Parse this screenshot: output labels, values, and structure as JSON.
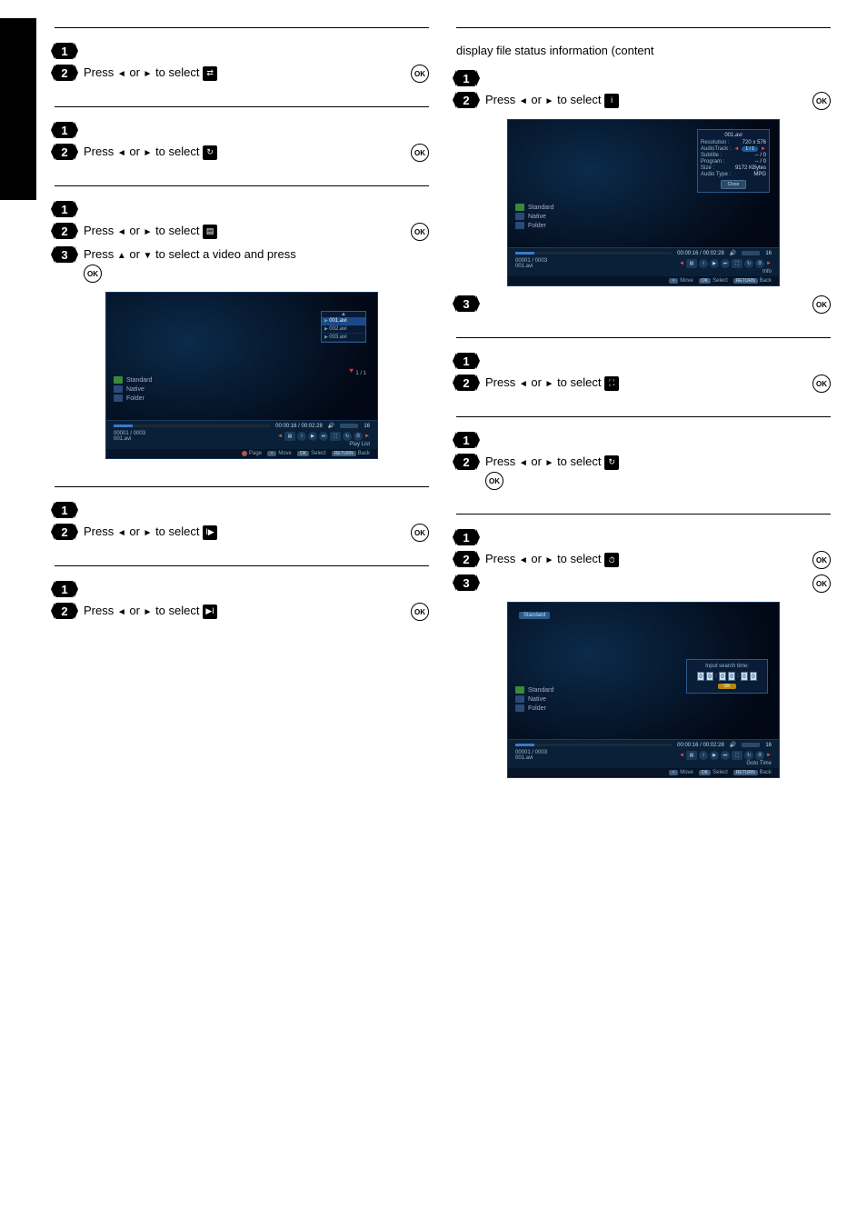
{
  "intro_para": "display file status information (content",
  "common": {
    "press_prefix": "Press ",
    "or": " or ",
    "to_select": " to select ",
    "press_updown_video": " to select a video and press",
    "ok": "OK"
  },
  "screenshots": {
    "sidebar": {
      "standard": "Standard",
      "native": "Native",
      "folder": "Folder"
    },
    "playlist": {
      "items": [
        "001.avi",
        "002.avi",
        "003.avi"
      ],
      "pager": "1 / 1",
      "label": "Play List"
    },
    "timebar": {
      "time": "00:00:16 / 00:02:28",
      "counter": "00001 / 0003",
      "filename": "001.avi",
      "chapter": "16"
    },
    "hints": {
      "page": "Page",
      "move": "Move",
      "select": "Select",
      "back": "Back",
      "ok": "OK",
      "return": "RETURN"
    },
    "info_panel": {
      "title": "001.avi",
      "rows": {
        "resolution_l": "Resolution :",
        "resolution_v": "720 x 576",
        "audiotrack_l": "AudioTrack :",
        "audiotrack_v": "1 / 1",
        "subtitle_l": "Subtitle :",
        "subtitle_v": "-- / 0",
        "program_l": "Program :",
        "program_v": "-- / 0",
        "size_l": "Size :",
        "size_v": "9172 KBytes",
        "audiotype_l": "Audio Type :",
        "audiotype_v": "MPG"
      },
      "close": "Close",
      "label": "Info"
    },
    "goto": {
      "badge": "Standard",
      "prompt": "Input search time:",
      "digits": [
        "0",
        "0",
        "0",
        "0",
        "0",
        "0"
      ],
      "ok": "OK",
      "label": "Goto Time"
    }
  }
}
